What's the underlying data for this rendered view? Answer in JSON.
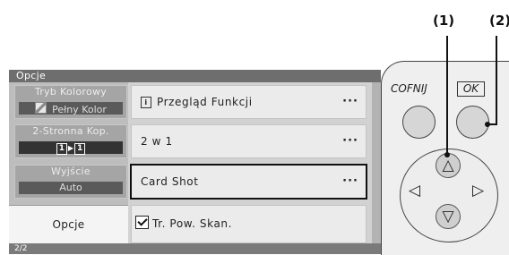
{
  "panel": {
    "title": "Opcje",
    "footer": "2/2",
    "left_buttons": [
      {
        "caption": "Tryb Kolorowy",
        "value": "Pełny Kolor"
      },
      {
        "caption": "2-Stronna Kop.",
        "left": "1",
        "arrow": "▶",
        "right": "1"
      },
      {
        "caption": "Wyjście",
        "value": "Auto"
      },
      {
        "caption": "Opcje"
      }
    ],
    "items": [
      {
        "icon": "i",
        "label": "Przegląd Funkcji",
        "more": "···"
      },
      {
        "label": "2 w 1",
        "more": "···"
      },
      {
        "label": "Card Shot",
        "more": "···"
      },
      {
        "label": "Tr. Pow. Skan.",
        "checked": true
      }
    ]
  },
  "controls": {
    "back_label": "COFNIJ",
    "ok_label": "OK",
    "up": "△",
    "down": "▽",
    "left": "◁",
    "right": "▷"
  },
  "callouts": [
    "(1)",
    "(2)"
  ]
}
